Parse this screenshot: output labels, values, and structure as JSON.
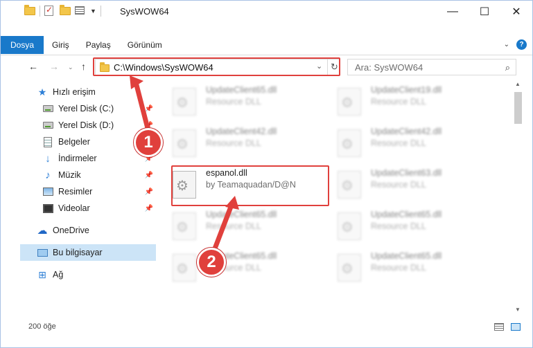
{
  "window": {
    "title": "SysWOW64",
    "controls": {
      "minimize": "—",
      "maximize": "☐",
      "close": "✕"
    }
  },
  "ribbon": {
    "tabs": [
      {
        "label": "Dosya",
        "active": true
      },
      {
        "label": "Giriş",
        "active": false
      },
      {
        "label": "Paylaş",
        "active": false
      },
      {
        "label": "Görünüm",
        "active": false
      }
    ],
    "help": "?"
  },
  "navigation": {
    "address": "C:\\Windows\\SysWOW64",
    "search_placeholder": "Ara: SysWOW64"
  },
  "sidebar": {
    "items": [
      {
        "label": "Hızlı erişim",
        "icon": "star-icon",
        "pinned": false
      },
      {
        "label": "Yerel Disk (C:)",
        "icon": "disk-icon",
        "pinned": true
      },
      {
        "label": "Yerel Disk (D:)",
        "icon": "disk-icon",
        "pinned": true
      },
      {
        "label": "Belgeler",
        "icon": "document-icon",
        "pinned": true
      },
      {
        "label": "İndirmeler",
        "icon": "download-icon",
        "pinned": true
      },
      {
        "label": "Müzik",
        "icon": "music-icon",
        "pinned": true
      },
      {
        "label": "Resimler",
        "icon": "pictures-icon",
        "pinned": true
      },
      {
        "label": "Videolar",
        "icon": "video-icon",
        "pinned": true
      },
      {
        "label": "OneDrive",
        "icon": "cloud-icon",
        "pinned": false
      },
      {
        "label": "Bu bilgisayar",
        "icon": "computer-icon",
        "pinned": false,
        "selected": true
      },
      {
        "label": "Ağ",
        "icon": "network-icon",
        "pinned": false
      }
    ]
  },
  "files": [
    {
      "name": "UpdateClient65.dll",
      "desc": "Resource DLL",
      "blurred": true
    },
    {
      "name": "UpdateClient19.dll",
      "desc": "Resource DLL",
      "blurred": true
    },
    {
      "name": "UpdateClient42.dll",
      "desc": "Resource DLL",
      "blurred": true
    },
    {
      "name": "UpdateClient42.dll",
      "desc": "Resource DLL",
      "blurred": true
    },
    {
      "name": "espanol.dll",
      "desc": "by Teamaquadan/D@N",
      "blurred": false
    },
    {
      "name": "UpdateClient63.dll",
      "desc": "Resource DLL",
      "blurred": true
    },
    {
      "name": "UpdateClient65.dll",
      "desc": "Resource DLL",
      "blurred": true
    },
    {
      "name": "UpdateClient65.dll",
      "desc": "Resource DLL",
      "blurred": true
    },
    {
      "name": "UpdateClient65.dll",
      "desc": "Resource DLL",
      "blurred": true
    },
    {
      "name": "UpdateClient65.dll",
      "desc": "Resource DLL",
      "blurred": true
    }
  ],
  "status": {
    "item_count": "200 öğe"
  },
  "callouts": {
    "one": "1",
    "two": "2"
  },
  "colors": {
    "accent": "#1979ca",
    "highlight": "#e0403c",
    "selected": "#cce4f7"
  }
}
